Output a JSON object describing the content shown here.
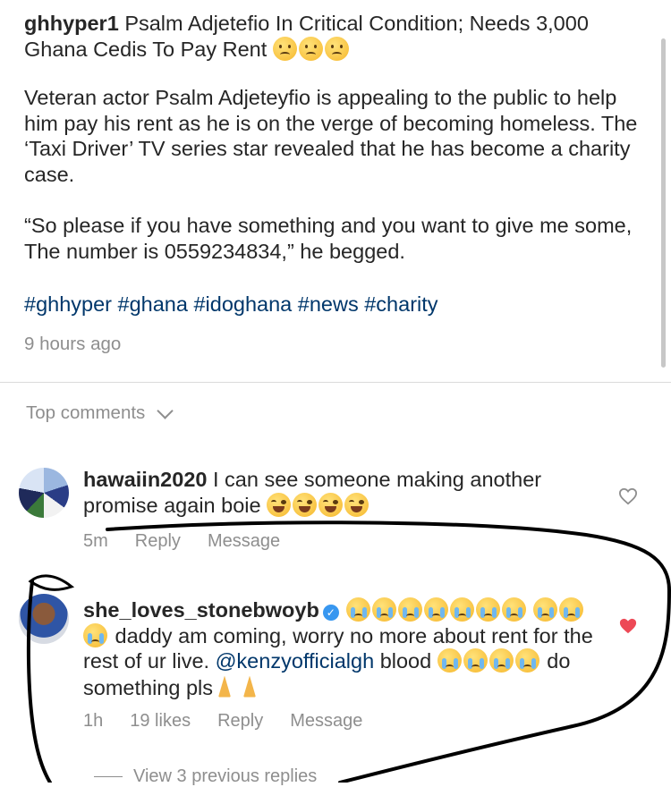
{
  "post": {
    "username": "ghhyper1",
    "headline": "Psalm Adjetefio In Critical Condition; Needs 3,000 Ghana Cedis To Pay Rent",
    "headline_emojis": [
      "confused-face-emoji",
      "confused-face-emoji",
      "confused-face-emoji"
    ],
    "paragraph1": "Veteran actor Psalm Adjeteyfio is appealing to the public to help him pay his rent as he is on the verge of becoming homeless. The ‘Taxi Driver’ TV series star revealed that he has become a charity case.",
    "paragraph2": "“So please if you have something and you want to give me some, The number is 0559234834,” he begged.",
    "hashtags": "#ghhyper #ghana #idoghana #news #charity",
    "time_ago": "9 hours ago"
  },
  "comments_header": {
    "label": "Top comments"
  },
  "comments": [
    {
      "username": "hawaiin2020",
      "text": "I can see someone making another promise again boie",
      "emojis": [
        "laughing-tears-emoji",
        "laughing-tears-emoji",
        "laughing-tears-emoji",
        "laughing-tears-emoji"
      ],
      "time": "5m",
      "likes": "",
      "reply_label": "Reply",
      "message_label": "Message",
      "liked": false
    },
    {
      "username": "she_loves_stonebwoyb",
      "verified": true,
      "leading_emojis": [
        "crying-face-emoji",
        "crying-face-emoji",
        "crying-face-emoji",
        "crying-face-emoji",
        "crying-face-emoji",
        "crying-face-emoji",
        "crying-face-emoji",
        "crying-face-emoji",
        "crying-face-emoji",
        "crying-face-emoji"
      ],
      "text_part1": "daddy am coming, worry no more about rent for the rest of ur live.",
      "mention": "@kenzyofficialgh",
      "text_part2": "blood",
      "text_part3": "do something pls",
      "middle_emojis": [
        "crying-face-emoji",
        "crying-face-emoji",
        "crying-face-emoji",
        "crying-face-emoji"
      ],
      "trailing_emojis": [
        "folded-hands-emoji",
        "folded-hands-emoji"
      ],
      "time": "1h",
      "likes": "19 likes",
      "reply_label": "Reply",
      "message_label": "Message",
      "liked": true
    }
  ],
  "view_replies": "View 3 previous replies",
  "colors": {
    "text": "#262626",
    "secondary": "#8e8e8e",
    "link": "#00376b",
    "liked_heart": "#ed4956",
    "annotation_ink": "#000000"
  }
}
